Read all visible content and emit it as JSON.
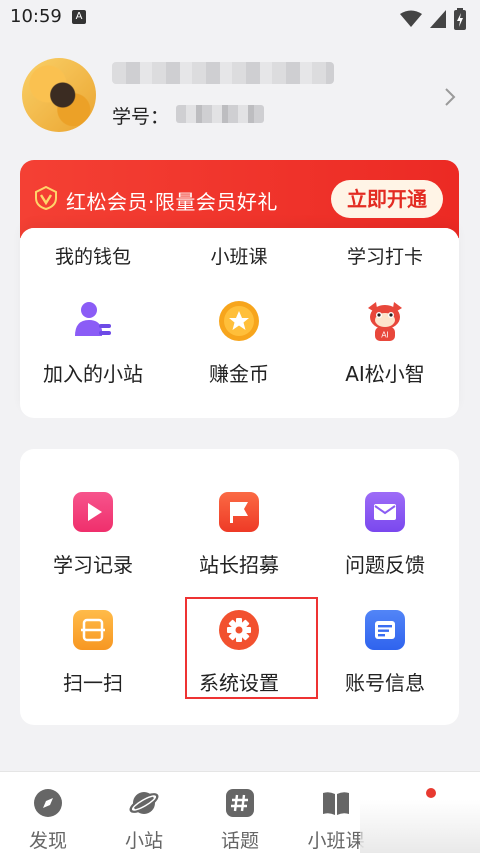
{
  "status_bar": {
    "time": "10:59",
    "notification_letter": "A"
  },
  "profile": {
    "student_id_label": "学号："
  },
  "vip": {
    "text": "红松会员·限量会员好礼",
    "button": "立即开通",
    "color": "#f03a2e"
  },
  "card1": {
    "cut_row": [
      "我的钱包",
      "小班课",
      "学习打卡"
    ],
    "items": [
      {
        "label": "加入的小站",
        "icon": "person-list-icon"
      },
      {
        "label": "赚金币",
        "icon": "star-coin-icon"
      },
      {
        "label": "AI松小智",
        "icon": "squirrel-mascot-icon"
      }
    ]
  },
  "card2": {
    "items": [
      {
        "label": "学习记录",
        "icon": "play-icon"
      },
      {
        "label": "站长招募",
        "icon": "flag-icon"
      },
      {
        "label": "问题反馈",
        "icon": "mail-icon"
      },
      {
        "label": "扫一扫",
        "icon": "scan-icon"
      },
      {
        "label": "系统设置",
        "icon": "gear-icon"
      },
      {
        "label": "账号信息",
        "icon": "document-icon"
      }
    ]
  },
  "bottom_nav": [
    {
      "label": "发现",
      "icon": "compass-icon"
    },
    {
      "label": "小站",
      "icon": "planet-icon"
    },
    {
      "label": "话题",
      "icon": "hashtag-icon"
    },
    {
      "label": "小班课",
      "icon": "book-icon"
    }
  ]
}
